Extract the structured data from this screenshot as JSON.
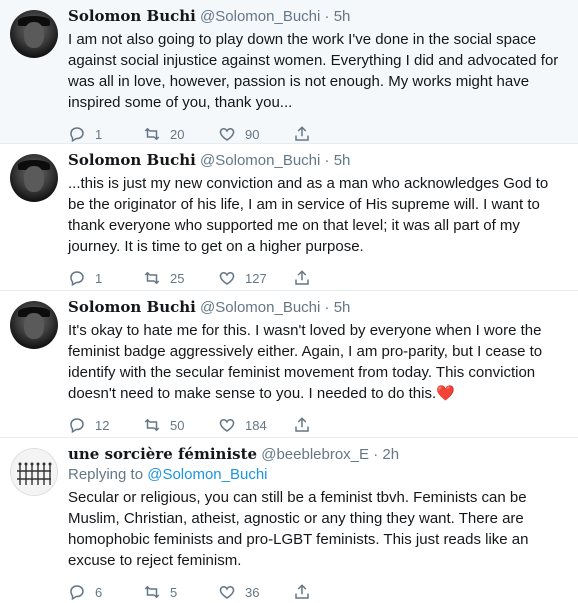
{
  "tweets": [
    {
      "name": "Solomon Buchi",
      "handle": "@Solomon_Buchi",
      "dot": "·",
      "time": "5h",
      "text": "I am not also going to play down the work I've done in the social space against social injustice against women. Everything I did and advocated for was all in love, however, passion is not enough. My works might have inspired some of you, thank you...",
      "replies": "1",
      "retweets": "20",
      "likes": "90"
    },
    {
      "name": "Solomon Buchi",
      "handle": "@Solomon_Buchi",
      "dot": "·",
      "time": "5h",
      "text": "...this is just my new conviction and as a man who acknowledges God to be the originator of his life, I am in service of His supreme will. I want to thank everyone who supported me on that level; it was all part of my journey. It is time to get on a higher purpose.",
      "replies": "1",
      "retweets": "25",
      "likes": "127"
    },
    {
      "name": "Solomon Buchi",
      "handle": "@Solomon_Buchi",
      "dot": "·",
      "time": "5h",
      "text": "It's okay to hate me for this. I wasn't loved by everyone when I wore the feminist badge aggressively either. Again, I am pro-parity, but I cease to identify with the secular feminist movement from today. This conviction doesn't need to make sense to you. I needed to do this.",
      "emoji": "❤️",
      "replies": "12",
      "retweets": "50",
      "likes": "184"
    },
    {
      "name": "une sorcière féministe",
      "handle": "@beeblebrox_E",
      "dot": "·",
      "time": "2h",
      "reply_prefix": "Replying to",
      "reply_handle": "@Solomon_Buchi",
      "text": "Secular or religious, you can still be a feminist tbvh. Feminists can be Muslim, Christian, atheist, agnostic or any thing they want. There are homophobic feminists and pro-LGBT feminists. This just reads like an excuse to reject feminism.",
      "replies": "6",
      "retweets": "5",
      "likes": "36"
    }
  ],
  "icons": {
    "reply": "reply-icon",
    "retweet": "retweet-icon",
    "like": "heart-icon",
    "share": "share-icon"
  },
  "colors": {
    "link": "#1b95e0",
    "secondary_text": "#657786",
    "highlight_bg": "#f5f8fa",
    "emoji_heart": "#e0245e"
  }
}
